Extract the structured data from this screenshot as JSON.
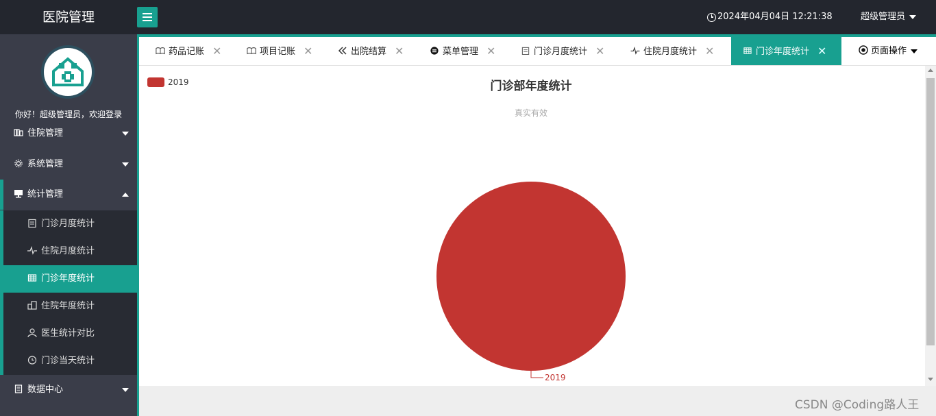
{
  "header": {
    "app_title": "医院管理",
    "datetime": "2024年04月04日 12:21:38",
    "admin_name": "超级管理员"
  },
  "sidebar": {
    "welcome": "你好！超级管理员，欢迎登录",
    "groups": [
      {
        "label": "住院管理",
        "icon": "bed-icon",
        "open": false
      },
      {
        "label": "系统管理",
        "icon": "gear-icon",
        "open": false
      },
      {
        "label": "统计管理",
        "icon": "monitor-icon",
        "open": true
      },
      {
        "label": "数据中心",
        "icon": "document-icon",
        "open": false
      }
    ],
    "sub_items": [
      {
        "label": "门诊月度统计",
        "icon": "clipboard-icon",
        "active": false
      },
      {
        "label": "住院月度统计",
        "icon": "pulse-icon",
        "active": false
      },
      {
        "label": "门诊年度统计",
        "icon": "table-icon",
        "active": true
      },
      {
        "label": "住院年度统计",
        "icon": "building-icon",
        "active": false
      },
      {
        "label": "医生统计对比",
        "icon": "user-icon",
        "active": false
      },
      {
        "label": "门诊当天统计",
        "icon": "clock-icon",
        "active": false
      }
    ]
  },
  "tabs": [
    {
      "label": "药品记账",
      "icon": "book-icon",
      "active": false
    },
    {
      "label": "项目记账",
      "icon": "book-icon",
      "active": false
    },
    {
      "label": "出院结算",
      "icon": "double-left-icon",
      "active": false
    },
    {
      "label": "菜单管理",
      "icon": "menu-circle-icon",
      "active": false
    },
    {
      "label": "门诊月度统计",
      "icon": "clipboard-icon",
      "active": false
    },
    {
      "label": "住院月度统计",
      "icon": "pulse-icon",
      "active": false
    },
    {
      "label": "门诊年度统计",
      "icon": "table-icon",
      "active": true
    }
  ],
  "page_ops_label": "页面操作",
  "chart_data": {
    "type": "pie",
    "title": "门诊部年度统计",
    "subtitle": "真实有效",
    "legend": [
      "2019"
    ],
    "legend_position": "top-left",
    "slices": [
      {
        "name": "2019",
        "value": 1,
        "color": "#c23531"
      }
    ]
  },
  "colors": {
    "accent": "#18a090",
    "header_bg": "#23262e",
    "sidebar_bg": "#3a3d49",
    "slice": "#c23531"
  },
  "watermark": "CSDN @Coding路人王"
}
